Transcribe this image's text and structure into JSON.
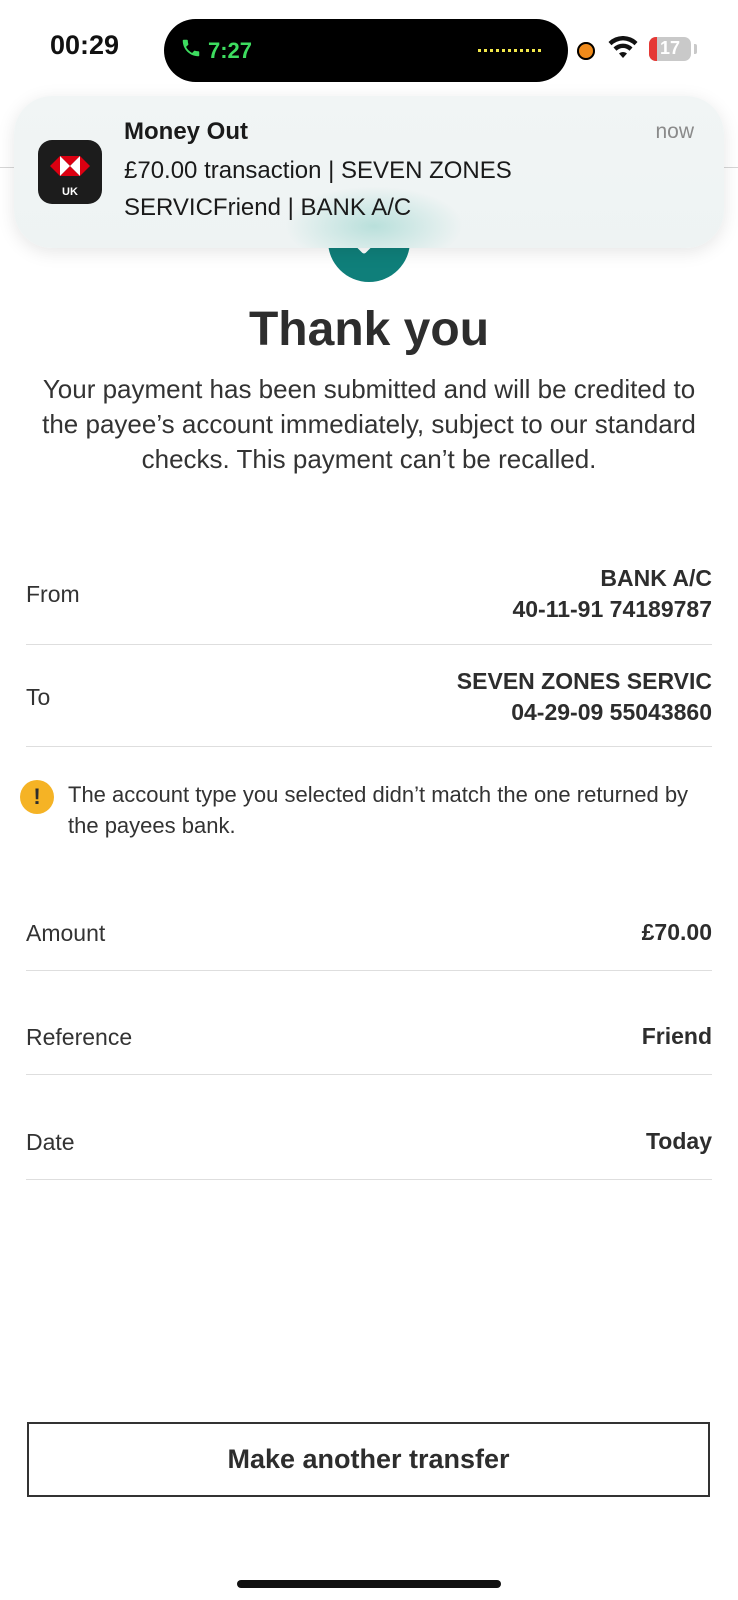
{
  "status_bar": {
    "time": "00:29",
    "call_timer": "7:27",
    "battery": "17"
  },
  "notification": {
    "title": "Money Out",
    "time": "now",
    "body": "£70.00 transaction | SEVEN ZONES SERVICFriend | BANK A/C",
    "app_badge": "UK"
  },
  "confirmation": {
    "heading": "Thank you",
    "message": "Your payment has been submitted and will be credited to the payee’s account immediately, subject to our standard checks. This payment can’t be recalled."
  },
  "details": {
    "from": {
      "label": "From",
      "line1": "BANK A/C",
      "line2": "40-11-91 74189787"
    },
    "to": {
      "label": "To",
      "line1": "SEVEN ZONES SERVIC",
      "line2": "04-29-09 55043860"
    },
    "warning": "The account type you selected didn’t match the one returned by the payees bank.",
    "amount": {
      "label": "Amount",
      "value": "£70.00"
    },
    "reference": {
      "label": "Reference",
      "value": "Friend"
    },
    "date": {
      "label": "Date",
      "value": "Today"
    }
  },
  "actions": {
    "make_another_transfer": "Make another transfer"
  },
  "colors": {
    "accent": "#0f7f7a",
    "warning": "#f5b325",
    "call_green": "#3ddc5f"
  }
}
